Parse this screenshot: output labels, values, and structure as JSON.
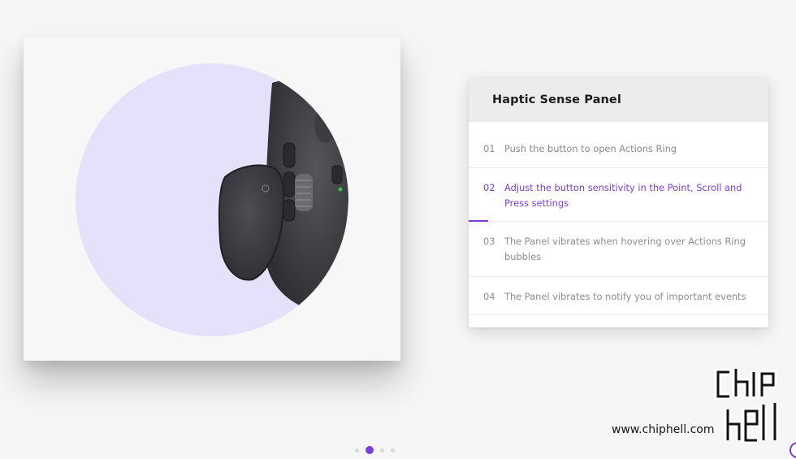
{
  "panel": {
    "title": "Haptic Sense Panel",
    "steps": [
      {
        "num": "01",
        "text": "Push the button to open Actions Ring"
      },
      {
        "num": "02",
        "text": "Adjust the button sensitivity in the Point, Scroll and Press settings"
      },
      {
        "num": "03",
        "text": "The Panel vibrates when hovering over Actions Ring bubbles"
      },
      {
        "num": "04",
        "text": "The Panel vibrates to notify you of important events"
      }
    ],
    "active_step": 2
  },
  "carousel": {
    "total": 4,
    "active": 2
  },
  "watermark": {
    "site": "www.chiphell.com"
  },
  "colors": {
    "accent": "#7b3ee0",
    "circle": "#e6e1fb",
    "mouse": "#3a3b3f"
  }
}
